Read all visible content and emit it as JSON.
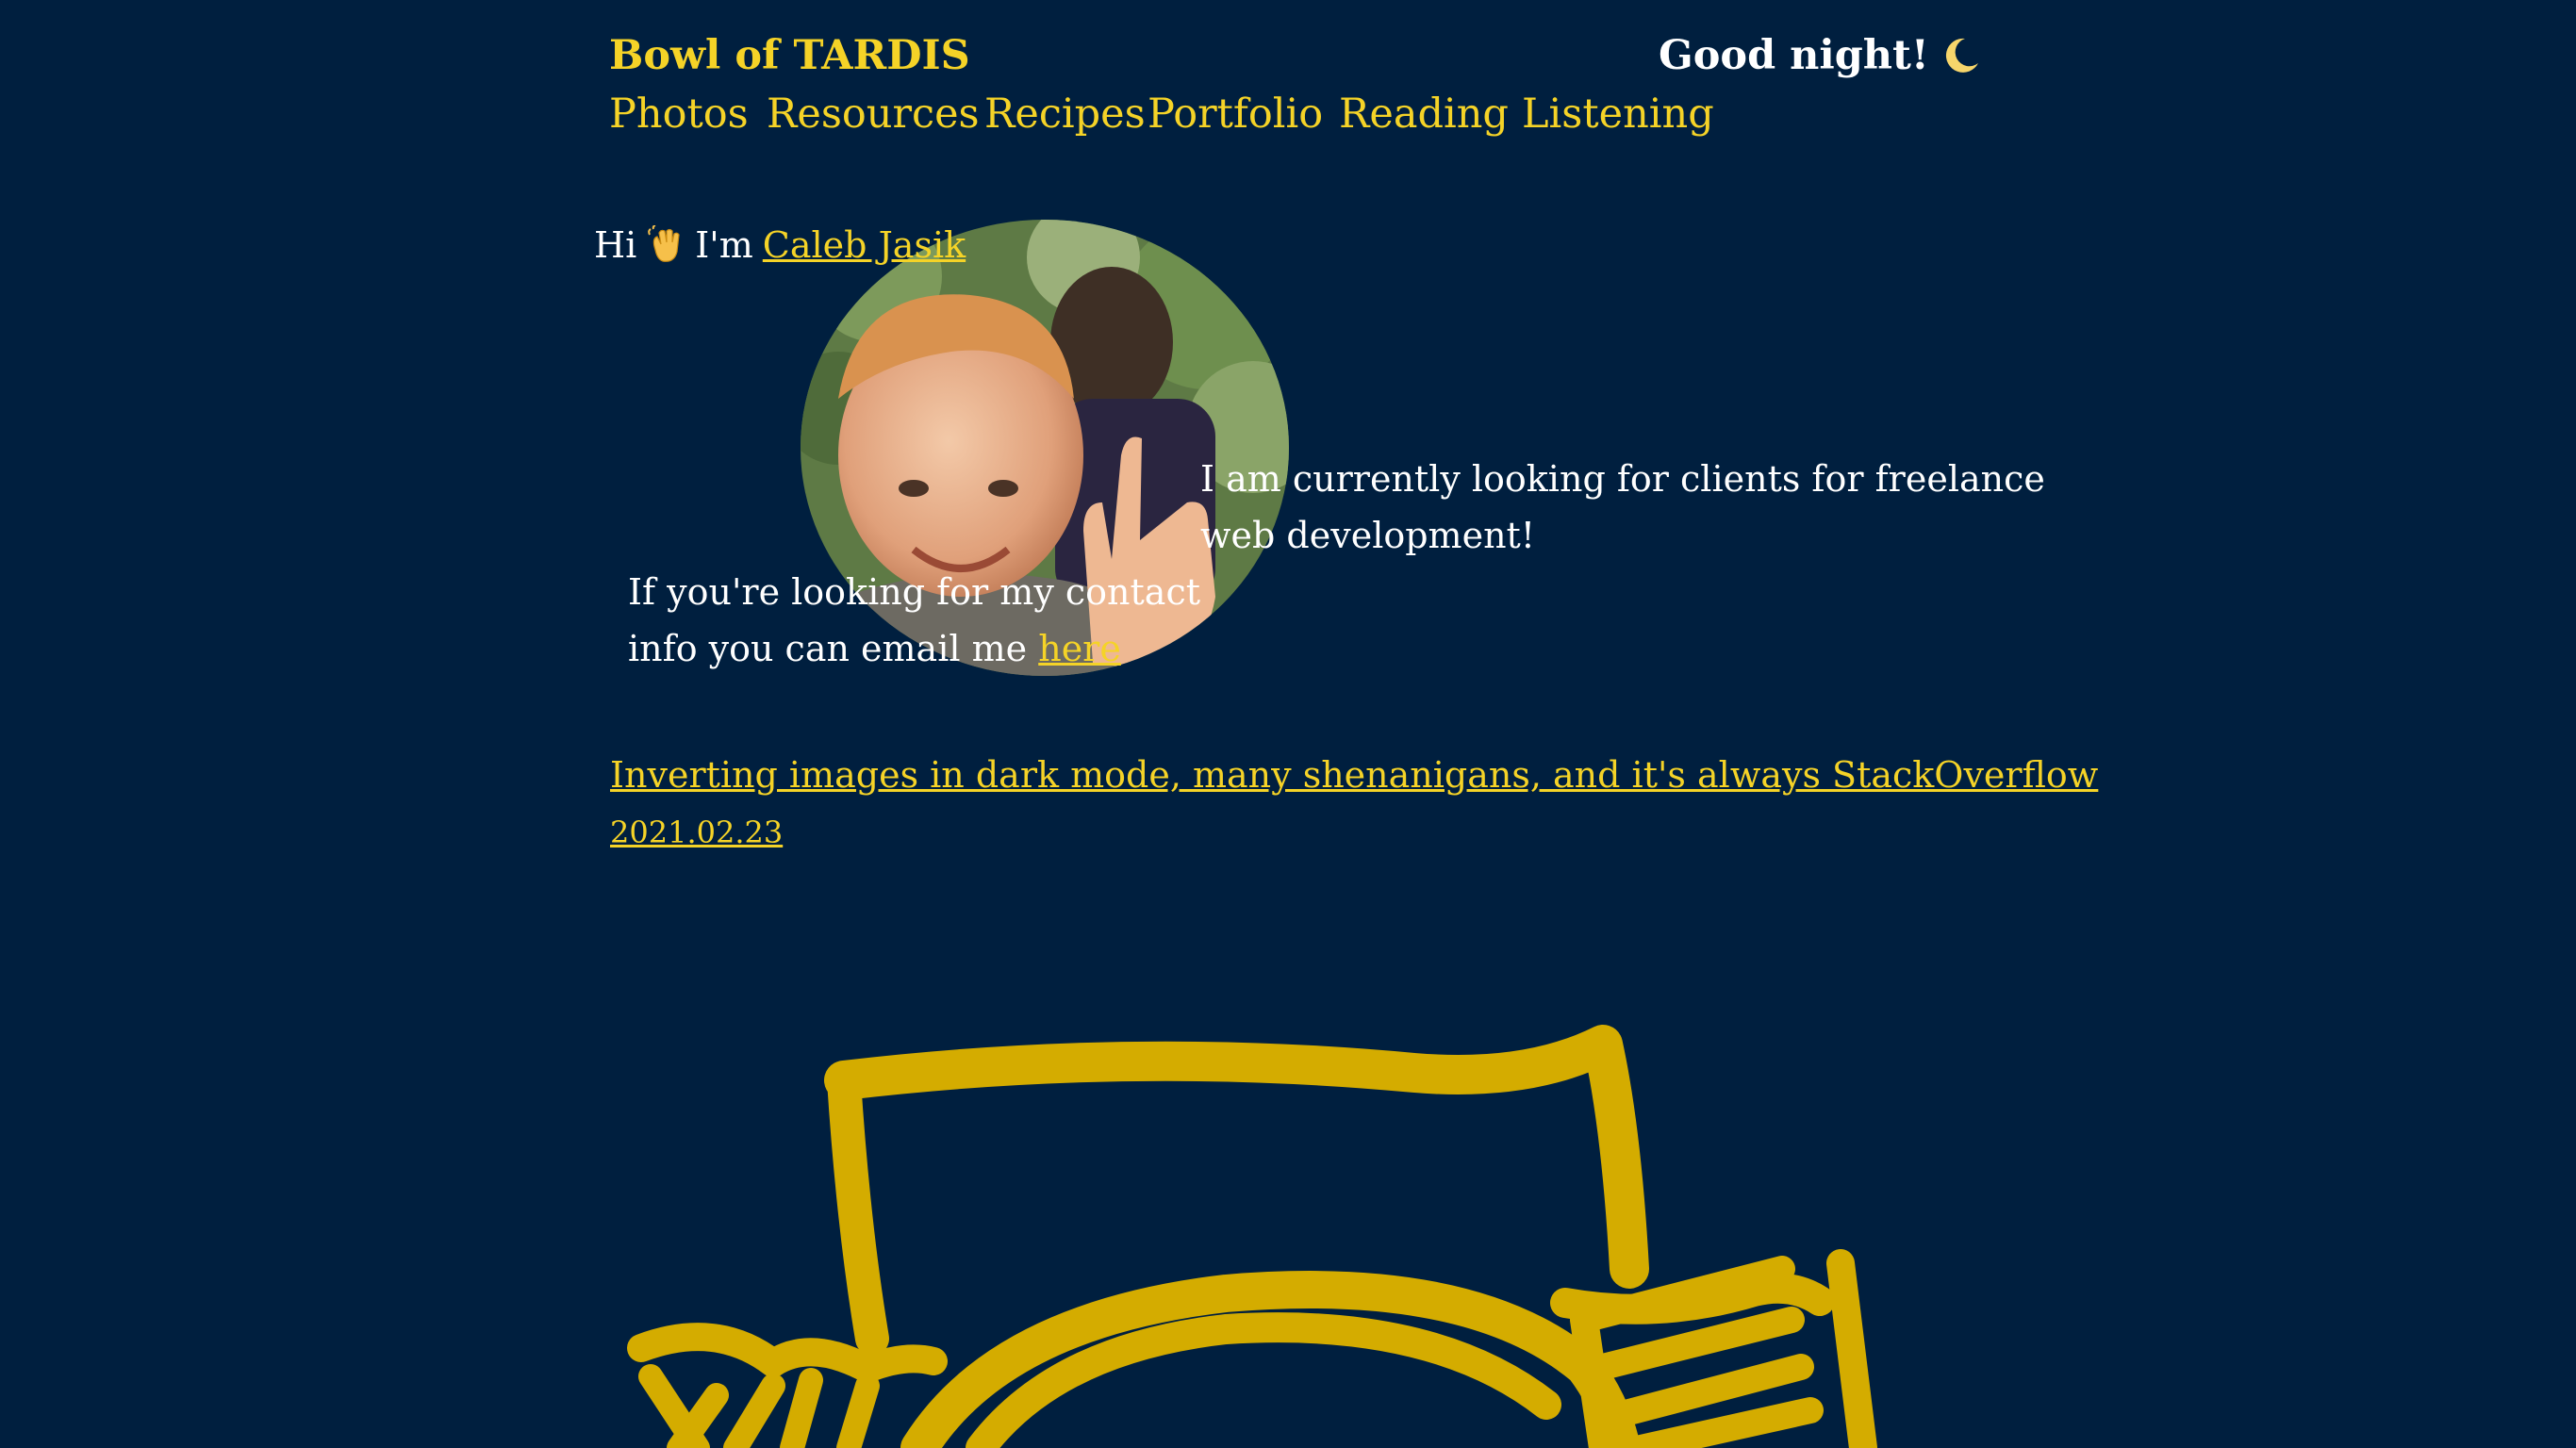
{
  "header": {
    "site_title": "Bowl of TARDIS",
    "greeting": "Good night!",
    "greeting_icon": "crescent-moon-icon"
  },
  "nav": {
    "items": [
      {
        "label": "Photos"
      },
      {
        "label": "Resources"
      },
      {
        "label": "Recipes"
      },
      {
        "label": "Portfolio"
      },
      {
        "label": "Reading"
      },
      {
        "label": "Listening"
      }
    ]
  },
  "intro": {
    "hi_text": "Hi",
    "wave_icon": "waving-hand-icon",
    "im_text": "I'm",
    "name_link": "Caleb Jasik",
    "freelance_text": "I am currently looking for clients for freelance web development!",
    "contact_text": "If you're looking for my contact info you can email me",
    "contact_link": "here"
  },
  "posts": [
    {
      "title": "Inverting images in dark mode, many shenanigans, and it's always StackOverflow",
      "date": "2021.02.23"
    }
  ],
  "colors": {
    "background": "#001f3f",
    "accent": "#f5d327",
    "drawing": "#d4ac00",
    "text": "#ffffff"
  }
}
